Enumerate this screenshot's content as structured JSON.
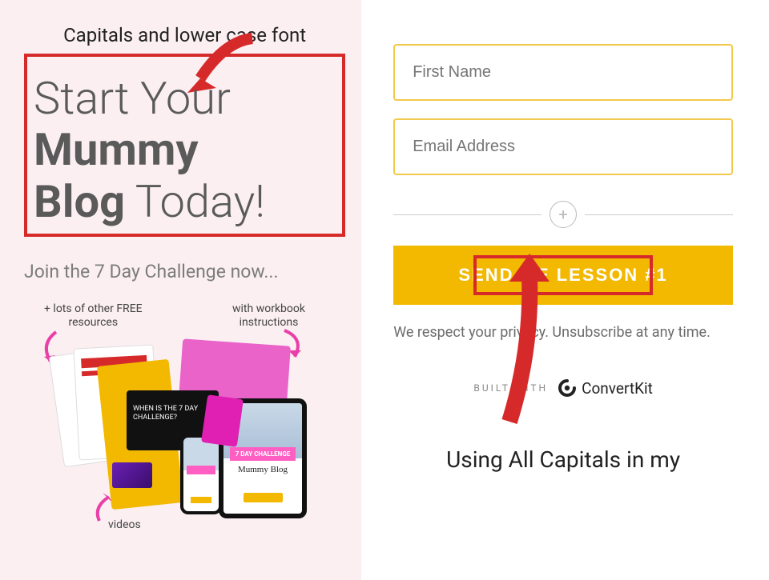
{
  "left": {
    "annotation_top": "Capitals and lower case font",
    "headline_light_1": "Start Your",
    "headline_bold_1": "Mummy",
    "headline_bold_2": "Blog",
    "headline_light_2": " Today!",
    "subheading": "Join the 7 Day Challenge now...",
    "mockup": {
      "resources_line1": "+ lots of other FREE",
      "resources_line2": "resources",
      "workbook_line1": "with workbook",
      "workbook_line2": "instructions",
      "videos": "videos",
      "challenge_label": "7 DAY CHALLENGE"
    }
  },
  "right": {
    "first_name_placeholder": "First Name",
    "email_placeholder": "Email Address",
    "cta_label": "SEND ME LESSON #1",
    "privacy": "We respect your privacy. Unsubscribe at any time.",
    "built_with": "BUILT WITH",
    "brand": "ConvertKit",
    "annotation_bottom": "Using All Capitals in my"
  },
  "colors": {
    "accent_red": "#D62A2A",
    "input_border": "#F2C94C",
    "cta_bg": "#F2B900"
  }
}
